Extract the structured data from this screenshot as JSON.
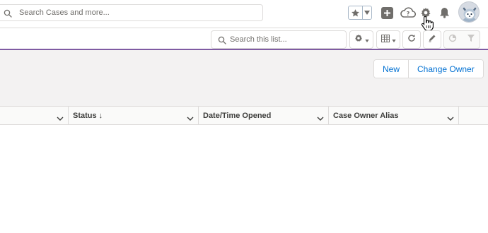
{
  "global_header": {
    "search_placeholder": "Search Cases and more...",
    "icons": [
      "search-icon",
      "star-icon",
      "chevron-down-icon",
      "plus-icon",
      "help-icon",
      "gear-icon",
      "bell-icon",
      "avatar"
    ]
  },
  "list_view": {
    "actions": {
      "new_label": "New",
      "change_owner_label": "Change Owner"
    },
    "search_placeholder": "Search this list...",
    "tools": [
      "gear-icon",
      "table-icon",
      "refresh-icon",
      "edit-icon",
      "chart-icon",
      "filter-icon"
    ]
  },
  "columns": [
    {
      "label": ""
    },
    {
      "label": "Status",
      "sort": "↓"
    },
    {
      "label": "Date/Time Opened"
    },
    {
      "label": "Case Owner Alias"
    }
  ],
  "colors": {
    "accent": "#7f5ba3",
    "link": "#0070d2",
    "icon_gray": "#706e6b",
    "border": "#dddbda"
  }
}
